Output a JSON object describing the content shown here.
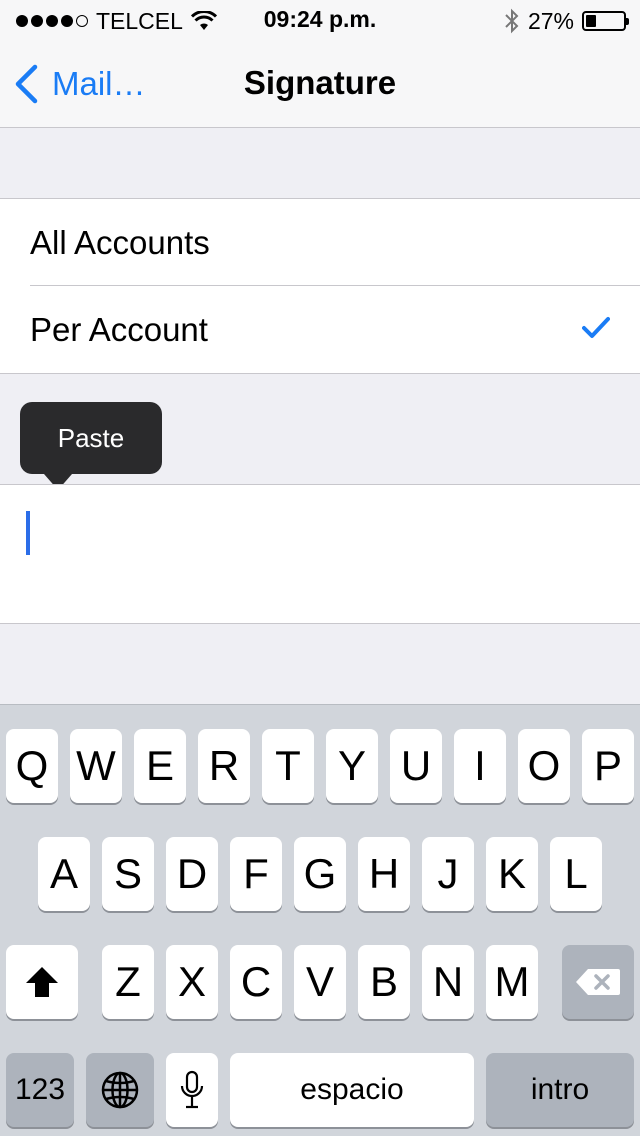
{
  "status_bar": {
    "carrier": "TELCEL",
    "time": "09:24 p.m.",
    "battery": "27%",
    "battery_level": 0.27,
    "signal_bars_filled": 4,
    "signal_bars_total": 5,
    "icons": [
      "wifi-icon",
      "bluetooth-icon",
      "battery-icon"
    ]
  },
  "nav": {
    "back_label": "Mail…",
    "title": "Signature"
  },
  "options": [
    {
      "label": "All Accounts",
      "selected": false
    },
    {
      "label": "Per Account",
      "selected": true
    }
  ],
  "paste_menu": {
    "label": "Paste"
  },
  "keyboard": {
    "row1": [
      "Q",
      "W",
      "E",
      "R",
      "T",
      "Y",
      "U",
      "I",
      "O",
      "P"
    ],
    "row2": [
      "A",
      "S",
      "D",
      "F",
      "G",
      "H",
      "J",
      "K",
      "L"
    ],
    "row3": [
      "Z",
      "X",
      "C",
      "V",
      "B",
      "N",
      "M"
    ],
    "numbers_label": "123",
    "space_label": "espacio",
    "return_label": "intro"
  },
  "colors": {
    "accent": "#1a7cf5",
    "cursor": "#2b6de8",
    "background": "#efeff4",
    "keyboard_bg": "#d1d5db"
  }
}
